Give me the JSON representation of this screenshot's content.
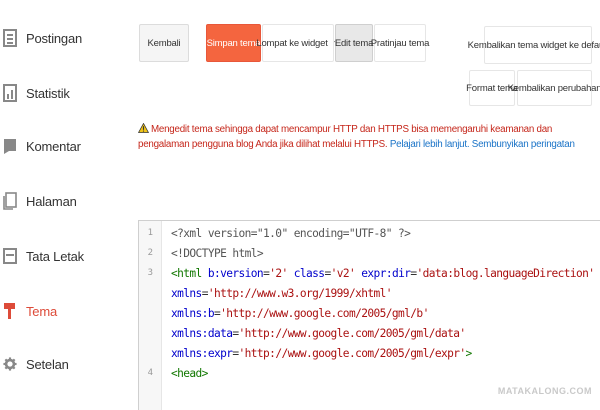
{
  "sidebar": {
    "items": [
      {
        "label": "Postingan",
        "icon": "posts-icon"
      },
      {
        "label": "Statistik",
        "icon": "stats-icon"
      },
      {
        "label": "Komentar",
        "icon": "comment-icon"
      },
      {
        "label": "Halaman",
        "icon": "page-icon"
      },
      {
        "label": "Tata Letak",
        "icon": "layout-icon"
      },
      {
        "label": "Tema",
        "icon": "theme-icon",
        "active": true
      },
      {
        "label": "Setelan",
        "icon": "gear-icon"
      }
    ]
  },
  "toolbar": {
    "back_label": "Kembali",
    "save_label": "Simpan tema",
    "jump_label": "Lompat ke widget",
    "edit_label": "Edit tema",
    "preview_label": "Pratinjau tema",
    "restore_widget_label": "Kembalikan tema widget ke default",
    "format_label": "Format tema",
    "revert_label": "Kembalikan perubahan"
  },
  "warning": {
    "message": "Mengedit tema sehingga dapat mencampur HTTP dan HTTPS bisa memengaruhi keamanan dan pengalaman pengguna blog Anda jika dilihat melalui HTTPS.",
    "learn_more": "Pelajari lebih lanjut.",
    "hide": "Sembunyikan peringatan"
  },
  "editor": {
    "lines": [
      {
        "num": "1",
        "parts": [
          [
            "t-meta",
            "<?xml version=\"1.0\" encoding=\"UTF-8\" ?>"
          ]
        ]
      },
      {
        "num": "2",
        "parts": [
          [
            "t-meta",
            "<!DOCTYPE html>"
          ]
        ]
      },
      {
        "num": "3",
        "parts": [
          [
            "t-tag",
            "<html "
          ],
          [
            "t-attr",
            "b:version"
          ],
          [
            "t-plain",
            "="
          ],
          [
            "t-str",
            "'2'"
          ],
          [
            "t-plain",
            " "
          ],
          [
            "t-attr",
            "class"
          ],
          [
            "t-plain",
            "="
          ],
          [
            "t-str",
            "'v2'"
          ],
          [
            "t-plain",
            " "
          ],
          [
            "t-attr",
            "expr:dir"
          ],
          [
            "t-plain",
            "="
          ],
          [
            "t-str",
            "'data:blog.languageDirection'"
          ]
        ]
      },
      {
        "num": "",
        "parts": [
          [
            "t-attr",
            "xmlns"
          ],
          [
            "t-plain",
            "="
          ],
          [
            "t-str",
            "'http://www.w3.org/1999/xhtml'"
          ]
        ]
      },
      {
        "num": "",
        "parts": [
          [
            "t-attr",
            "xmlns:b"
          ],
          [
            "t-plain",
            "="
          ],
          [
            "t-str",
            "'http://www.google.com/2005/gml/b'"
          ]
        ]
      },
      {
        "num": "",
        "parts": [
          [
            "t-attr",
            "xmlns:data"
          ],
          [
            "t-plain",
            "="
          ],
          [
            "t-str",
            "'http://www.google.com/2005/gml/data'"
          ]
        ]
      },
      {
        "num": "",
        "parts": [
          [
            "t-attr",
            "xmlns:expr"
          ],
          [
            "t-plain",
            "="
          ],
          [
            "t-str",
            "'http://www.google.com/2005/gml/expr'"
          ],
          [
            "t-tag",
            ">"
          ]
        ]
      },
      {
        "num": "4",
        "parts": [
          [
            "t-tag",
            "<head>"
          ]
        ]
      }
    ]
  },
  "watermark": "MATAKALONG.COM",
  "colors": {
    "accent": "#f4653f",
    "active_nav": "#dd4b39",
    "warning": "#c5261a",
    "link": "#1a73c7"
  }
}
